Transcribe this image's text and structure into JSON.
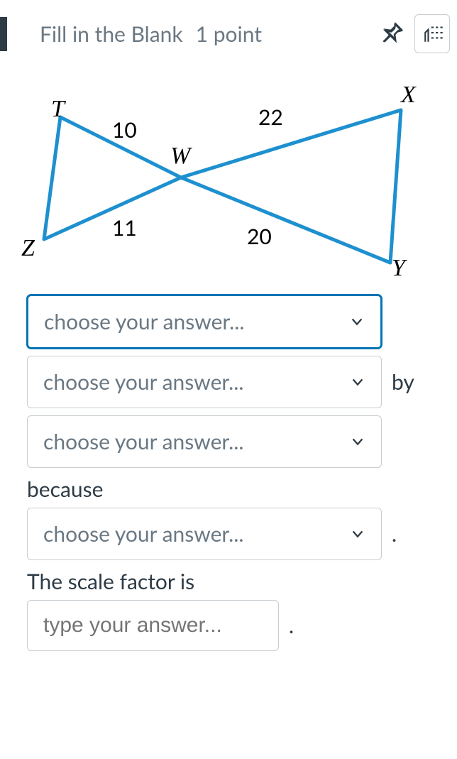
{
  "header": {
    "question_type": "Fill in the Blank",
    "points": "1 point"
  },
  "diagram": {
    "labels": {
      "T": "T",
      "Z": "Z",
      "W": "W",
      "X": "X",
      "Y": "Y",
      "len_10": "10",
      "len_11": "11",
      "len_22": "22",
      "len_20": "20"
    }
  },
  "answers": {
    "select1_placeholder": "choose your answer...",
    "select2_placeholder": "choose your answer...",
    "by_text": "by",
    "select3_placeholder": "choose your answer...",
    "because_text": "because",
    "select4_placeholder": "choose your answer...",
    "period": ".",
    "scale_text": "The scale factor is",
    "type_placeholder": "type your answer...",
    "period2": "."
  }
}
